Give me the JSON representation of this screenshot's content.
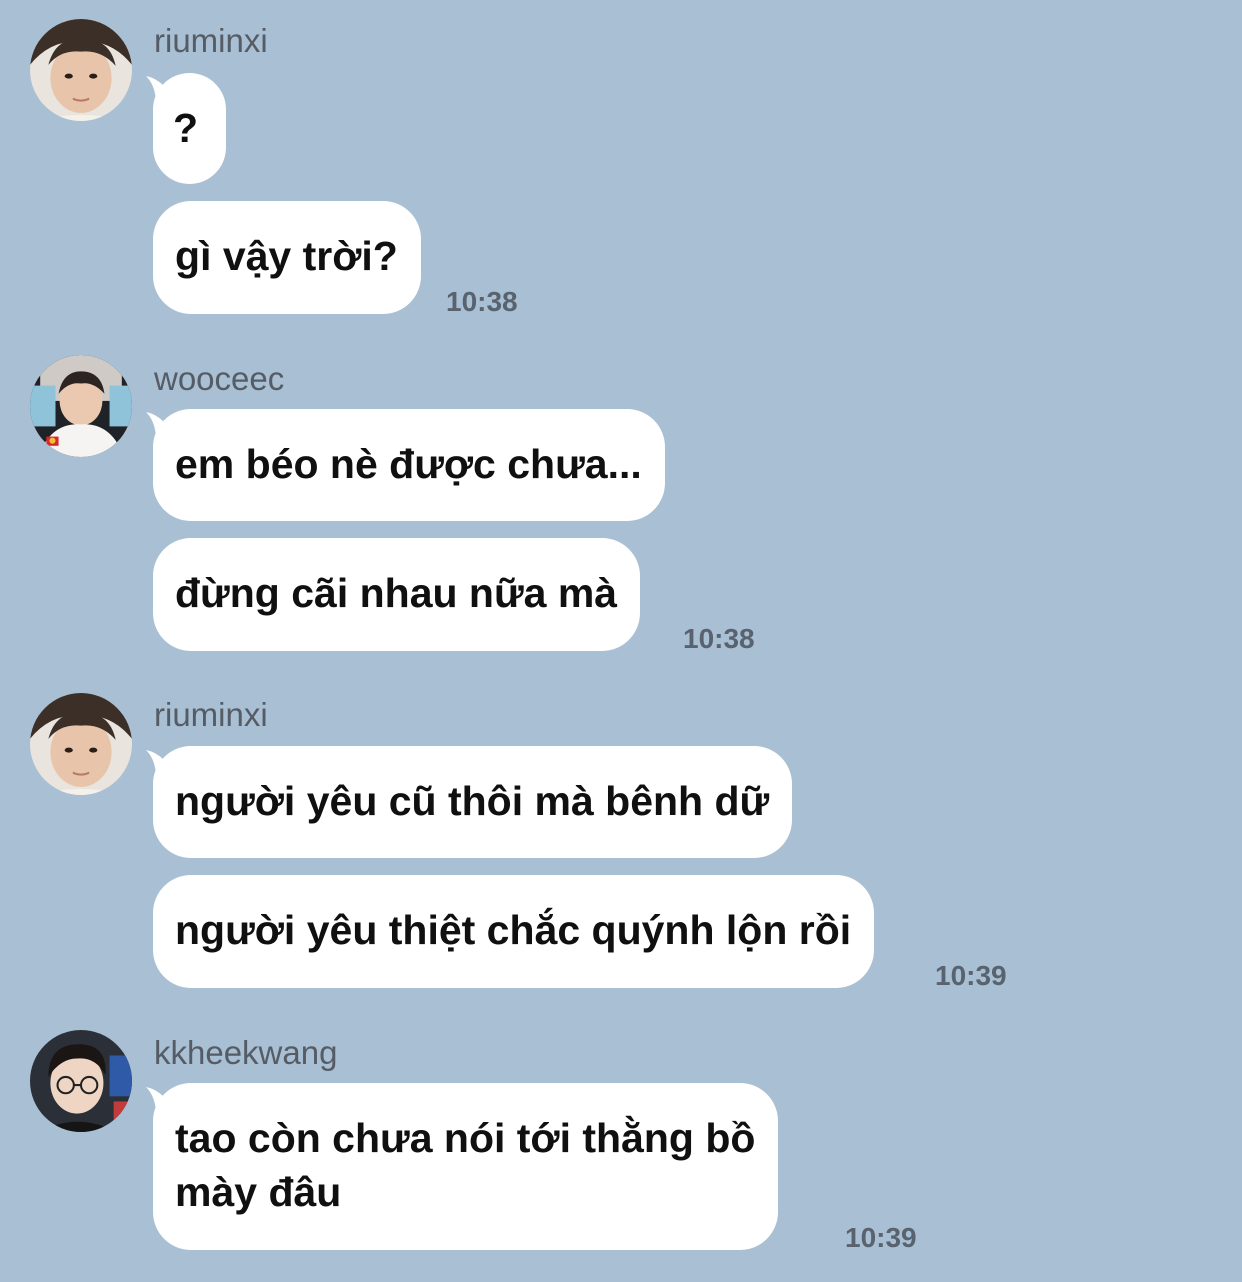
{
  "messages": [
    {
      "username": "riuminxi",
      "avatar": "riuminxi-avatar",
      "bubbles": [
        "?",
        "gì vậy trời?"
      ],
      "time": "10:38"
    },
    {
      "username": "wooceec",
      "avatar": "wooceec-avatar",
      "bubbles": [
        "em béo nè được chưa...",
        "đừng cãi nhau nữa mà"
      ],
      "time": "10:38"
    },
    {
      "username": "riuminxi",
      "avatar": "riuminxi-avatar",
      "bubbles": [
        "người yêu cũ thôi mà bênh dữ",
        "người yêu thiệt chắc quýnh lộn rồi"
      ],
      "time": "10:39"
    },
    {
      "username": "kkheekwang",
      "avatar": "kkheekwang-avatar",
      "bubbles": [
        "tao còn chưa nói tới thằng bồ\nmày đâu"
      ],
      "time": "10:39"
    }
  ],
  "colors": {
    "background": "#a9bfd3",
    "bubble": "#ffffff",
    "username": "#555c66",
    "timestamp": "#596370"
  }
}
